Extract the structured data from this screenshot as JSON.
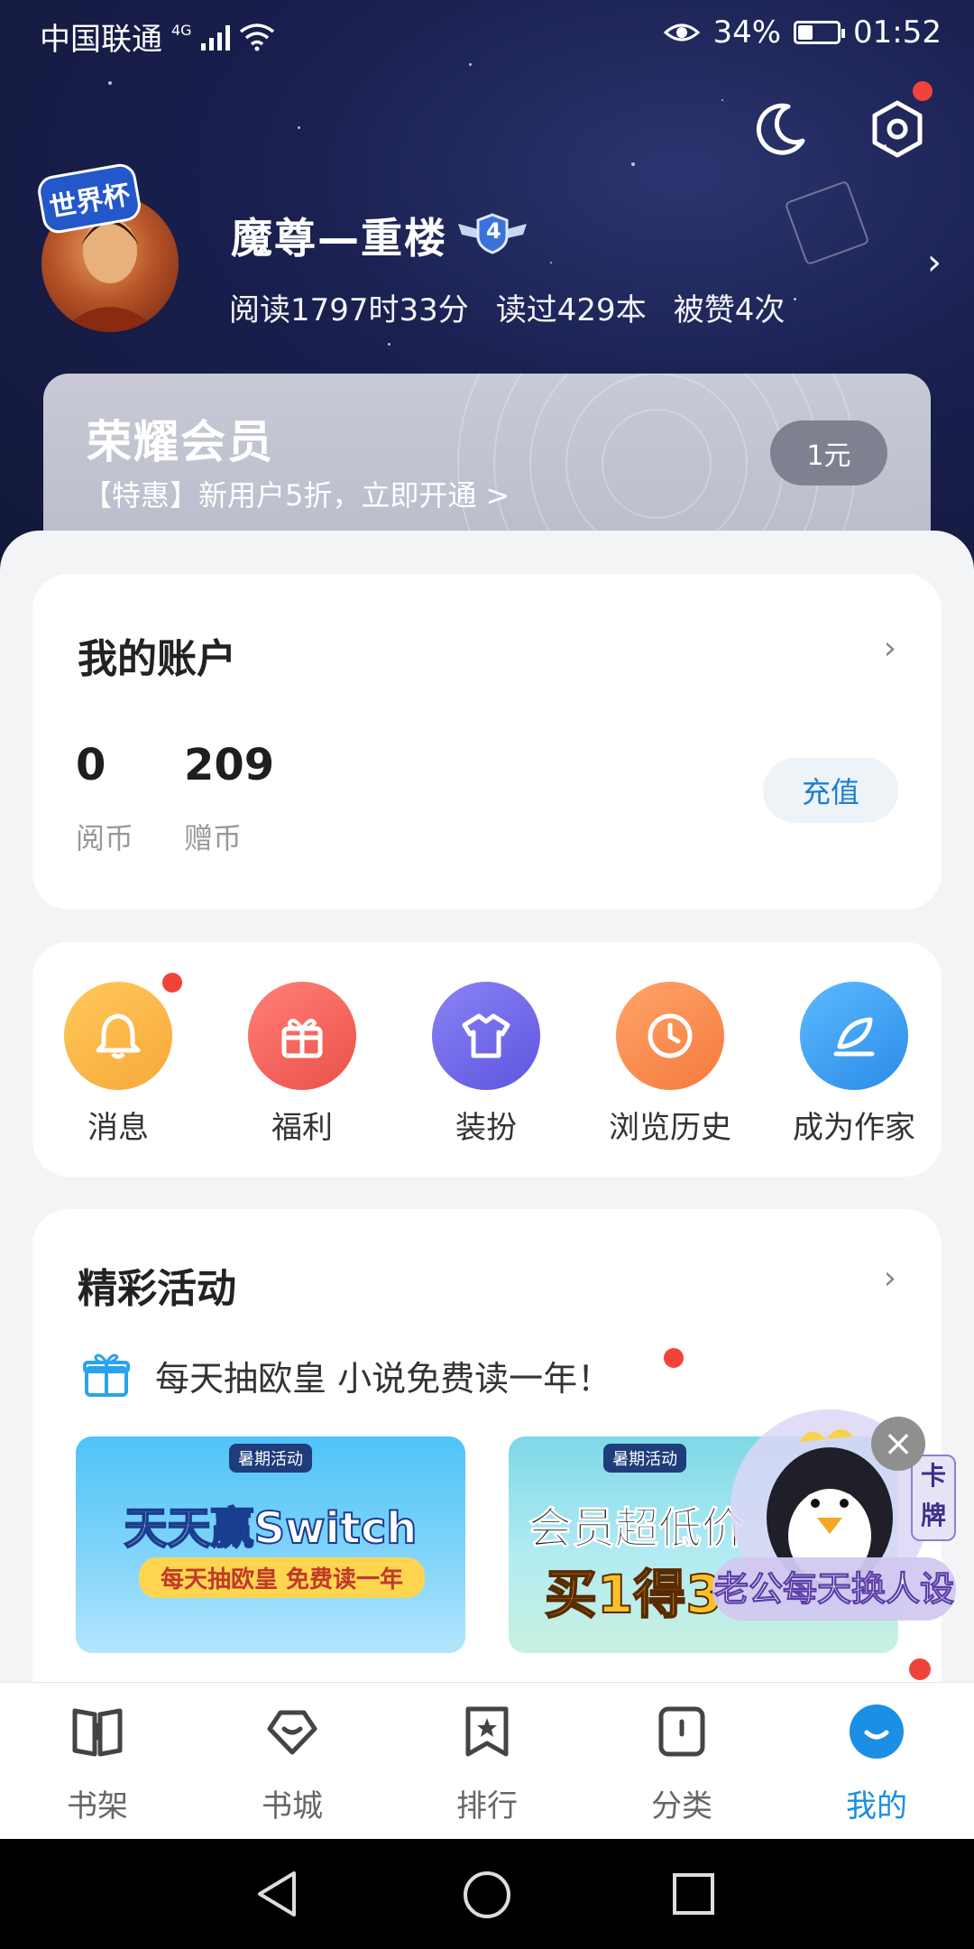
{
  "status_bar": {
    "carrier": "中国联通",
    "network": "4G",
    "battery": "34%",
    "time": "01:52"
  },
  "profile": {
    "avatar_badge": "世界杯",
    "username": "魔尊—重楼",
    "level": "4",
    "stats": [
      "阅读1797时33分",
      "读过429本",
      "被赞4次"
    ]
  },
  "vip": {
    "title": "荣耀会员",
    "subtitle": "【特惠】新用户5折，立即开通 >",
    "price": "1元"
  },
  "account": {
    "title": "我的账户",
    "balances": [
      {
        "value": "0",
        "label": "阅币"
      },
      {
        "value": "209",
        "label": "赠币"
      }
    ],
    "recharge_label": "充值"
  },
  "shortcuts": [
    {
      "label": "消息",
      "icon": "bell-icon",
      "color": "#fbb040"
    },
    {
      "label": "福利",
      "icon": "gift-icon",
      "color": "#f0605a"
    },
    {
      "label": "装扮",
      "icon": "shirt-icon",
      "color": "#6b63e8"
    },
    {
      "label": "浏览历史",
      "icon": "clock-icon",
      "color": "#f88a4e"
    },
    {
      "label": "成为作家",
      "icon": "pen-icon",
      "color": "#3fa2f0"
    }
  ],
  "activities": {
    "title": "精彩活动",
    "headline": "每天抽欧皇 小说免费读一年！",
    "banners": [
      {
        "tag": "暑期活动",
        "main": "天天赢Switch",
        "sub": "每天抽欧皇 免费读一年"
      },
      {
        "tag": "暑期活动",
        "main": "会员超低价",
        "line2": "买1得3"
      }
    ]
  },
  "floating_widget": {
    "close": "×",
    "card_label": "卡牌",
    "text": "老公每天换人设"
  },
  "bottom_nav": [
    {
      "label": "书架",
      "icon": "bookshelf-icon"
    },
    {
      "label": "书城",
      "icon": "bookstore-icon"
    },
    {
      "label": "排行",
      "icon": "ranking-icon"
    },
    {
      "label": "分类",
      "icon": "category-icon"
    },
    {
      "label": "我的",
      "icon": "profile-icon",
      "active": true
    }
  ],
  "colors": {
    "accent": "#1a8fe3",
    "notify": "#f0443a"
  }
}
